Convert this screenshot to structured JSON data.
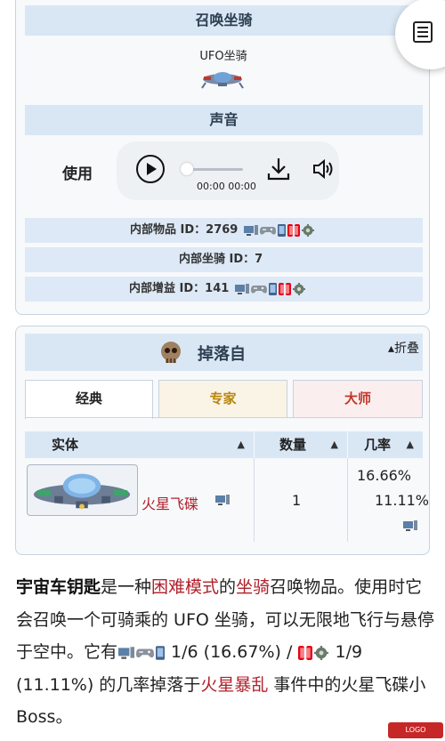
{
  "infobox": {
    "summon_header": "召唤坐骑",
    "item_name": "UFO坐骑",
    "sound_header": "声音",
    "use_label": "使用",
    "audio": {
      "time": "00:00 00:00"
    },
    "ids": {
      "item_label": "内部物品 ID：",
      "item_value": "2769",
      "mount_label": "内部坐骑 ID：",
      "mount_value": "7",
      "buff_label": "内部增益 ID：",
      "buff_value": "141"
    }
  },
  "drops": {
    "title": "掉落自",
    "collapse_label": "▴折叠",
    "tabs": [
      {
        "label": "经典",
        "color": "#222222"
      },
      {
        "label": "专家",
        "color": "#b8860b"
      },
      {
        "label": "大师",
        "color": "#c0392b"
      }
    ],
    "columns": {
      "entity": "实体",
      "quantity": "数量",
      "rate": "几率"
    },
    "row": {
      "entity": "火星飞碟",
      "quantity": "1",
      "rate_1": "16.66%",
      "rate_2": "11.11%"
    }
  },
  "paragraph": {
    "p1": "宇宙车钥匙",
    "p2": "是一种",
    "p3": "困难模式",
    "p4": "的",
    "p5": "坐骑",
    "p6": "召唤物品。使用时它会召唤一个可骑乘的 UFO 坐骑，可以无限地飞行与悬停于空中。它有",
    "p7": " 1/6 (16.67%) / ",
    "p8": " 1/9 (11.11%) 的几率掉落于",
    "p9": "火星暴乱",
    "p10": " 事件中的火星飞碟小Boss。"
  },
  "icons": {
    "menu": "list-icon",
    "play": "play-icon",
    "download": "download-icon",
    "volume": "volume-icon",
    "drop_source": "skull-icon",
    "platform_pc": "pc-icon",
    "platform_console": "gamepad-icon",
    "platform_mobile": "mobile-icon",
    "platform_switch": "switch-icon",
    "platform_tmod": "gear-icon"
  },
  "colors": {
    "header_bg": "#d9e7f5",
    "link_red": "#b0202a",
    "expert_gold": "#b8860b",
    "master_red": "#c0392b"
  }
}
